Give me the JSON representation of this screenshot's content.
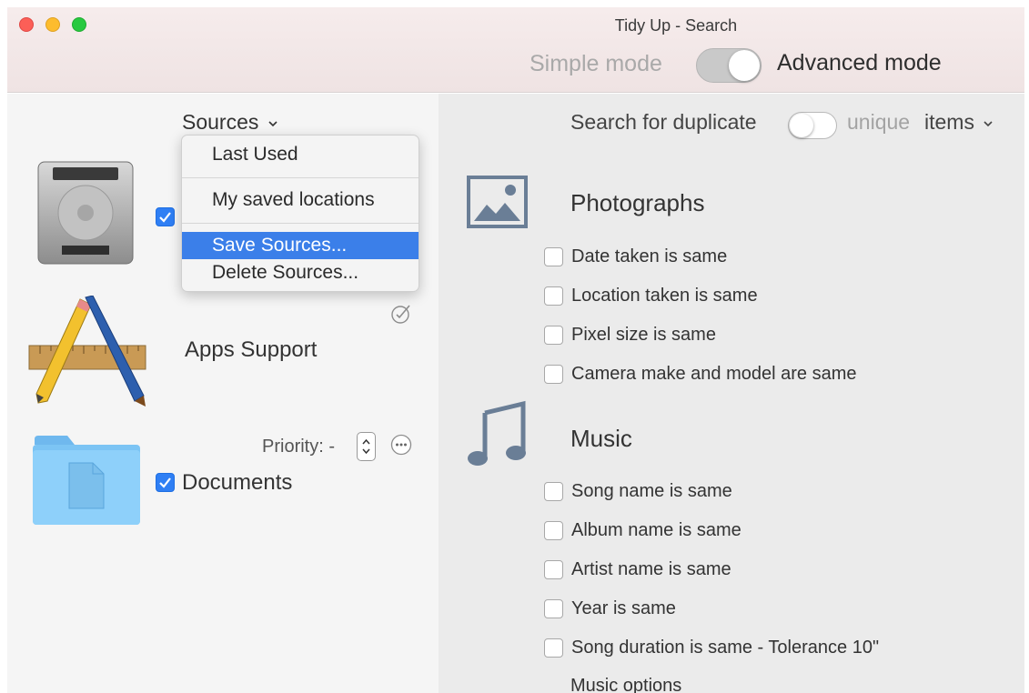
{
  "window": {
    "title": "Tidy Up - Search",
    "mode_simple_label": "Simple mode",
    "mode_advanced_label": "Advanced mode",
    "advanced_mode_on": true,
    "traffic_light_colors": {
      "close": "#fc5f57",
      "minimize": "#fdbc2e",
      "zoom": "#28c940"
    }
  },
  "left_pane": {
    "sources_label": "Sources",
    "sources_menu": {
      "items": [
        {
          "label": "Last Used"
        },
        {
          "label": "My saved locations"
        },
        {
          "label": "Save Sources...",
          "highlighted": true
        },
        {
          "label": "Delete Sources..."
        }
      ]
    },
    "items": [
      {
        "label": "",
        "icon": "hard-drive-icon",
        "checked": true
      },
      {
        "label": "Apps Support",
        "icon": "applications-icon",
        "status_icon": "checkmark-circle-icon"
      },
      {
        "label": "Documents",
        "icon": "documents-folder-icon",
        "checked": true,
        "priority_label": "Priority: -"
      }
    ]
  },
  "right_pane": {
    "search_label": "Search for duplicate",
    "unique_label": "unique",
    "items_label": "items",
    "unique_toggle_on": false,
    "categories": [
      {
        "title": "Photographs",
        "icon": "photo-icon",
        "options": [
          {
            "label": "Date taken is same",
            "checked": false
          },
          {
            "label": "Location taken is same",
            "checked": false
          },
          {
            "label": "Pixel size is same",
            "checked": false
          },
          {
            "label": "Camera make and model are same",
            "checked": false
          }
        ]
      },
      {
        "title": "Music",
        "icon": "music-note-icon",
        "options": [
          {
            "label": "Song name is same",
            "checked": false
          },
          {
            "label": "Album name is same",
            "checked": false
          },
          {
            "label": "Artist name is same",
            "checked": false
          },
          {
            "label": "Year is same",
            "checked": false
          },
          {
            "label": "Song duration is same - Tolerance 10\"",
            "checked": false
          }
        ]
      }
    ],
    "music_options_label": "Music options"
  },
  "colors": {
    "accent": "#3b7fe9",
    "checkbox_on": "#2f7ff4"
  }
}
